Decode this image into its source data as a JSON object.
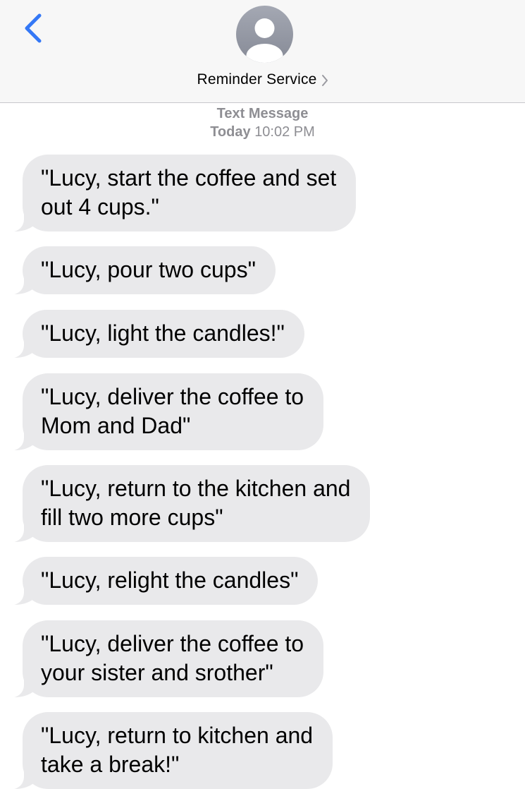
{
  "header": {
    "contact_name": "Reminder Service",
    "accent_color": "#3478f6",
    "back_icon": "chevron-left-icon",
    "avatar_icon": "person-silhouette-icon",
    "disclosure_icon": "chevron-right-icon"
  },
  "meta": {
    "service": "Text Message",
    "day": "Today",
    "time": "10:02 PM"
  },
  "messages": [
    {
      "text": "\"Lucy, start the coffee and set\nout 4 cups.\""
    },
    {
      "text": "\"Lucy, pour two cups\""
    },
    {
      "text": "\"Lucy, light the candles!\""
    },
    {
      "text": "\"Lucy, deliver the coffee to\nMom and Dad\""
    },
    {
      "text": "\"Lucy, return to the kitchen and\nfill two more cups\""
    },
    {
      "text": "\"Lucy, relight the candles\""
    },
    {
      "text": "\"Lucy, deliver the coffee to\nyour sister and srother\""
    },
    {
      "text": "\"Lucy, return to kitchen and\ntake a break!\""
    }
  ]
}
